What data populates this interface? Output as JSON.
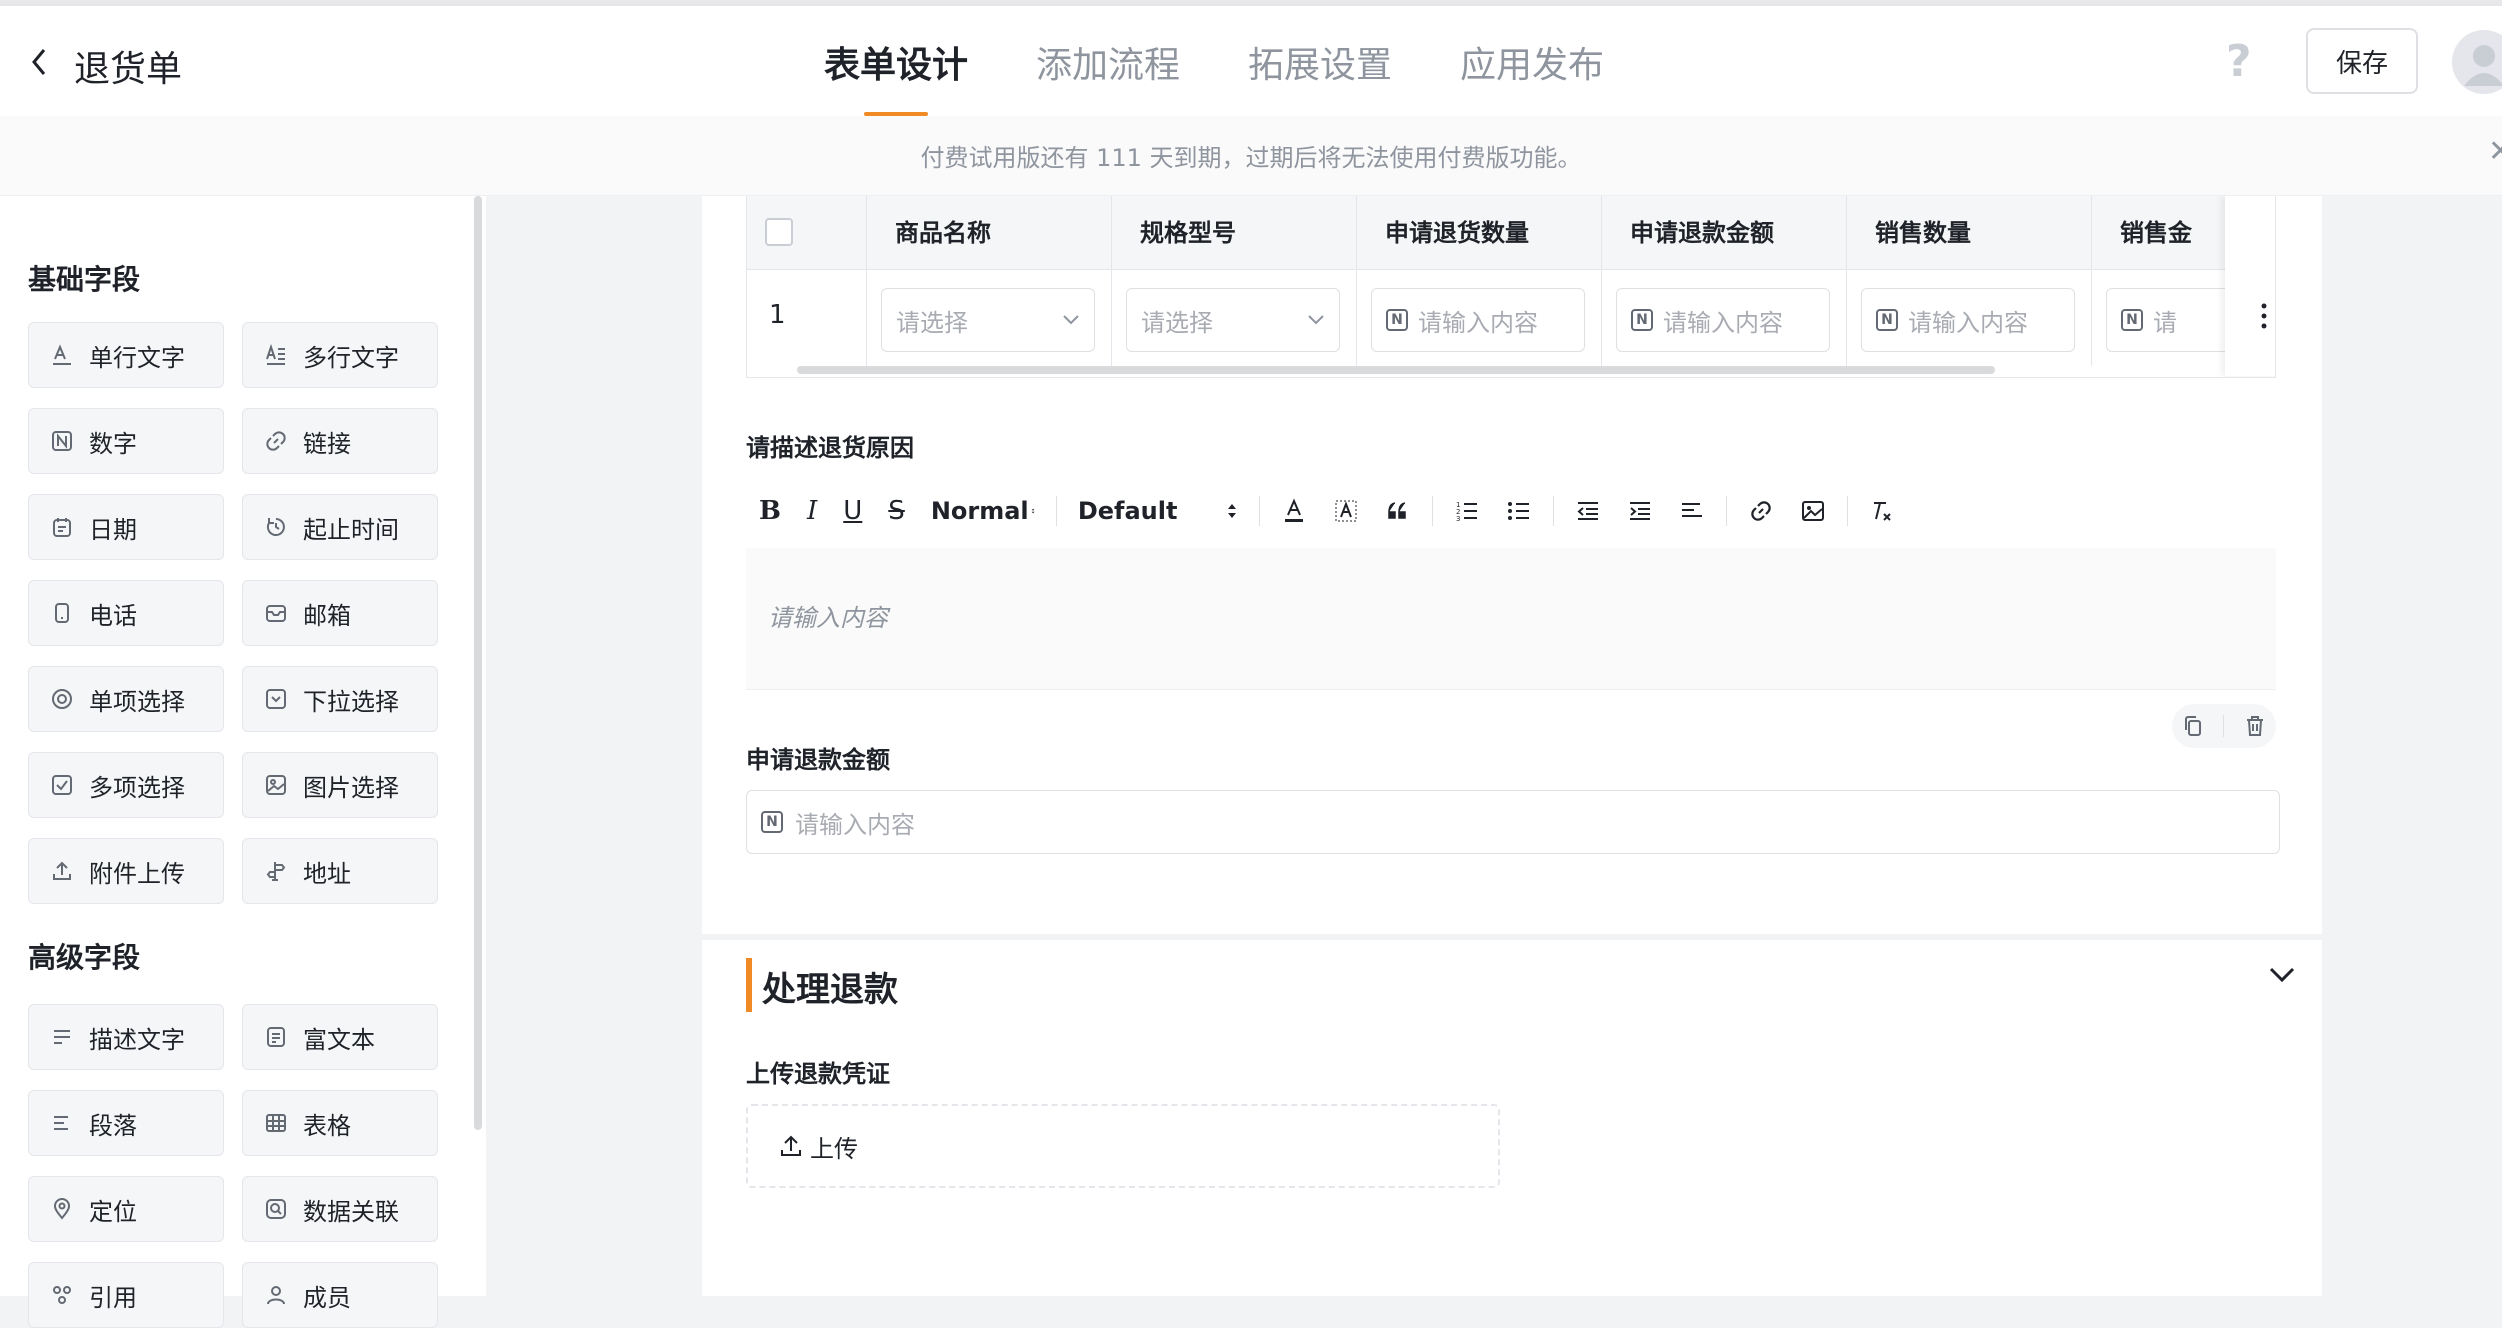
{
  "header": {
    "title": "退货单",
    "tabs": [
      {
        "label": "表单设计",
        "active": true
      },
      {
        "label": "添加流程"
      },
      {
        "label": "拓展设置"
      },
      {
        "label": "应用发布"
      }
    ],
    "help_glyph": "?",
    "save_label": "保存"
  },
  "banner": {
    "text": "付费试用版还有 111 天到期，过期后将无法使用付费版功能。",
    "close_glyph": "✕"
  },
  "sidebar": {
    "basic_title": "基础字段",
    "basic_fields": [
      "单行文字",
      "多行文字",
      "数字",
      "链接",
      "日期",
      "起止时间",
      "电话",
      "邮箱",
      "单项选择",
      "下拉选择",
      "多项选择",
      "图片选择",
      "附件上传",
      "地址"
    ],
    "advanced_title": "高级字段",
    "advanced_fields": [
      "描述文字",
      "富文本",
      "段落",
      "表格",
      "定位",
      "数据关联",
      "引用",
      "成员"
    ]
  },
  "table": {
    "columns": [
      "商品名称",
      "规格型号",
      "申请退货数量",
      "申请退款金额",
      "销售数量",
      "销售金"
    ],
    "row_index": "1",
    "select_placeholder": "请选择",
    "input_placeholder": "请输入内容",
    "input_placeholder_cut": "请"
  },
  "reason": {
    "label": "请描述退货原因",
    "toolbar_format": "Normal",
    "toolbar_font": "Default",
    "placeholder": "请输入内容"
  },
  "refund": {
    "label": "申请退款金额",
    "placeholder": "请输入内容"
  },
  "section": {
    "title": "处理退款",
    "upload_label": "上传退款凭证",
    "upload_button": "上传"
  },
  "colors": {
    "accent": "#f08a24",
    "text": "#1f2329",
    "muted": "#8f959e"
  }
}
